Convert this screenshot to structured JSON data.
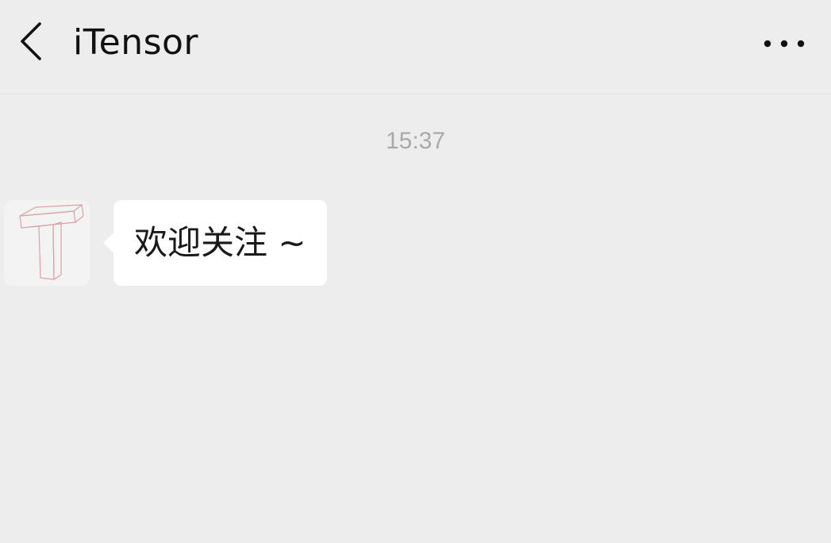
{
  "header": {
    "title": "iTensor",
    "back_icon": "chevron-left-icon",
    "more_icon": "more-dots-icon"
  },
  "chat": {
    "timestamp": "15:37",
    "messages": [
      {
        "sender_avatar_icon": "itensor-logo",
        "text": "欢迎关注 ~"
      }
    ]
  },
  "colors": {
    "background": "#ededed",
    "bubble": "#ffffff",
    "text": "#111111",
    "timestamp": "#a9a9a9",
    "logo_stroke": "#d9a3a3"
  }
}
